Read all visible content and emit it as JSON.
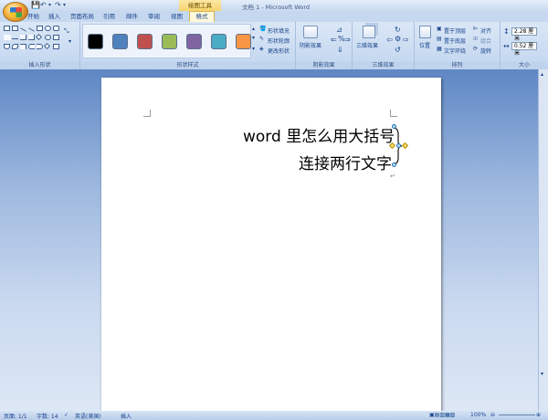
{
  "window": {
    "title": "文档 1 - Microsoft Word",
    "context_tab_group": "绘图工具"
  },
  "tabs": [
    "开始",
    "插入",
    "页面布局",
    "引用",
    "邮件",
    "审阅",
    "视图"
  ],
  "active_tab": "格式",
  "ribbon": {
    "groups": {
      "insert_shapes": "插入形状",
      "shape_styles": "形状样式",
      "shadow_effects": "阴影效果",
      "threed_effects": "三维效果",
      "arrange": "排列",
      "size": "大小"
    },
    "shape_fill": "形状填充",
    "shape_outline": "形状轮廓",
    "change_shape": "更改形状",
    "shadow_btn": "阴影效果",
    "threed_btn": "三维效果",
    "position_btn": "位置",
    "bring_front": "置于顶层",
    "send_back": "置于底层",
    "text_wrap": "文字环绕",
    "align": "对齐",
    "group": "组合",
    "rotate": "旋转",
    "height_value": "2.28 厘米",
    "width_value": "0.52 厘米",
    "swatch_colors": [
      "#000000",
      "#4f81bd",
      "#c0504d",
      "#9bbb59",
      "#8064a2",
      "#4bacc6",
      "#f79646"
    ]
  },
  "document": {
    "line1": "word 里怎么用大括号",
    "line2": "连接两行文字"
  },
  "status": {
    "page": "页面: 1/1",
    "words": "字数: 14",
    "lang": "英语(美国)",
    "mode": "插入",
    "zoom": "100%"
  }
}
